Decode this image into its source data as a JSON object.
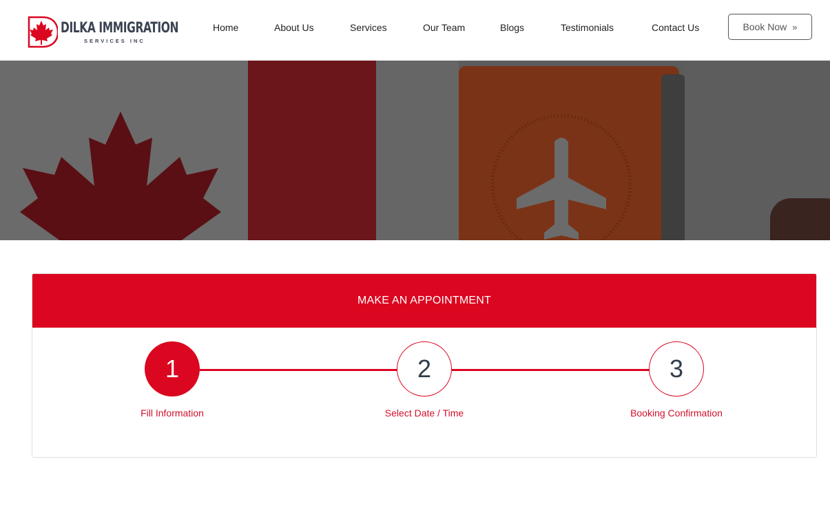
{
  "brand": {
    "name": "DILKA IMMIGRATION",
    "subtitle": "SERVICES INC"
  },
  "nav": {
    "items": [
      "Home",
      "About Us",
      "Services",
      "Our Team",
      "Blogs",
      "Testimonials",
      "Contact Us"
    ],
    "book_label": "Book Now",
    "book_icon": "double-chevron-right-icon"
  },
  "appointment": {
    "title": "MAKE AN APPOINTMENT",
    "current_step": 1,
    "steps": [
      {
        "number": "1",
        "label": "Fill Information"
      },
      {
        "number": "2",
        "label": "Select Date / Time"
      },
      {
        "number": "3",
        "label": "Booking Confirmation"
      }
    ]
  },
  "colors": {
    "accent": "#db0620",
    "text_dark": "#333e4a"
  }
}
